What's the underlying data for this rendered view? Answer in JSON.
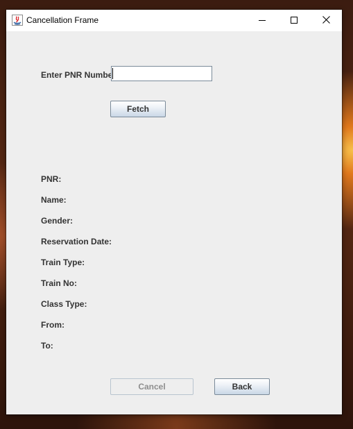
{
  "window": {
    "title": "Cancellation Frame",
    "controls": {
      "minimize": "minimize",
      "maximize": "maximize",
      "close": "close"
    }
  },
  "form": {
    "pnr_label": "Enter PNR Number",
    "pnr_value": "",
    "fetch_label": "Fetch"
  },
  "details": {
    "pnr_label": "PNR:",
    "name_label": "Name:",
    "gender_label": "Gender:",
    "reservation_date_label": "Reservation Date:",
    "train_type_label": "Train Type:",
    "train_no_label": "Train No:",
    "class_type_label": "Class Type:",
    "from_label": "From:",
    "to_label": "To:"
  },
  "actions": {
    "cancel_label": "Cancel",
    "cancel_enabled": false,
    "back_label": "Back"
  },
  "icons": {
    "app": "java-icon",
    "minimize": "minimize-icon",
    "maximize": "maximize-icon",
    "close": "close-icon"
  }
}
